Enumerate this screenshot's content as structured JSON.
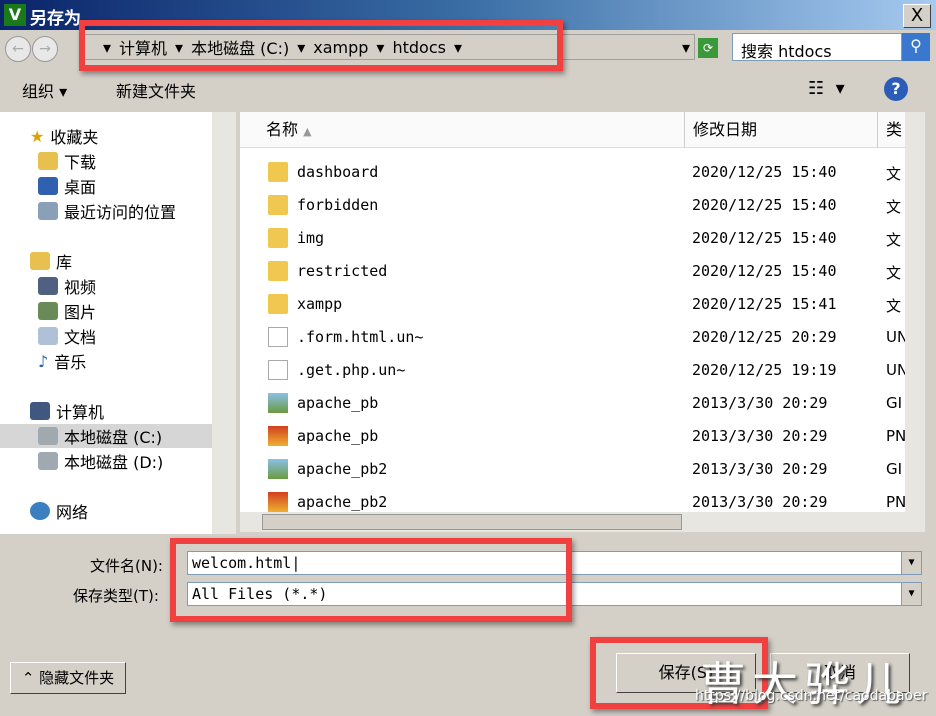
{
  "window": {
    "title": "另存为",
    "close": "X",
    "icon": "V"
  },
  "nav": {
    "breadcrumb": [
      "计算机",
      "本地磁盘 (C:)",
      "xampp",
      "htdocs"
    ],
    "search_placeholder": "搜索 htdocs"
  },
  "toolbar": {
    "organize": "组织",
    "new_folder": "新建文件夹",
    "help": "?"
  },
  "sidebar": {
    "favorites": {
      "label": "收藏夹",
      "items": [
        "下载",
        "桌面",
        "最近访问的位置"
      ]
    },
    "libraries": {
      "label": "库",
      "items": [
        "视频",
        "图片",
        "文档",
        "音乐"
      ]
    },
    "computer": {
      "label": "计算机",
      "items": [
        "本地磁盘 (C:)",
        "本地磁盘 (D:)"
      ]
    },
    "network": "网络"
  },
  "columns": [
    "名称",
    "修改日期",
    "类"
  ],
  "files": [
    {
      "name": "dashboard",
      "date": "2020/12/25 15:40",
      "type": "文",
      "icon": "folder"
    },
    {
      "name": "forbidden",
      "date": "2020/12/25 15:40",
      "type": "文",
      "icon": "folder"
    },
    {
      "name": "img",
      "date": "2020/12/25 15:40",
      "type": "文",
      "icon": "folder"
    },
    {
      "name": "restricted",
      "date": "2020/12/25 15:40",
      "type": "文",
      "icon": "folder"
    },
    {
      "name": "xampp",
      "date": "2020/12/25 15:41",
      "type": "文",
      "icon": "folder"
    },
    {
      "name": ".form.html.un~",
      "date": "2020/12/25 20:29",
      "type": "UN",
      "icon": "file"
    },
    {
      "name": ".get.php.un~",
      "date": "2020/12/25 19:19",
      "type": "UN",
      "icon": "file"
    },
    {
      "name": "apache_pb",
      "date": "2013/3/30 20:29",
      "type": "GI",
      "icon": "image"
    },
    {
      "name": "apache_pb",
      "date": "2013/3/30 20:29",
      "type": "PN",
      "icon": "image-png"
    },
    {
      "name": "apache_pb2",
      "date": "2013/3/30 20:29",
      "type": "GI",
      "icon": "image"
    },
    {
      "name": "apache_pb2",
      "date": "2013/3/30 20:29",
      "type": "PN",
      "icon": "image-png"
    }
  ],
  "form": {
    "filename_label": "文件名(N):",
    "filename": "welcom.html",
    "type_label": "保存类型(T):",
    "type": "All Files (*.*)"
  },
  "buttons": {
    "hide_folders": "隐藏文件夹",
    "save": "保存(S)",
    "cancel": "取消"
  },
  "watermark": {
    "text": "曹大骅儿",
    "url": "https://blog.csdn.net/caodabaoer"
  }
}
